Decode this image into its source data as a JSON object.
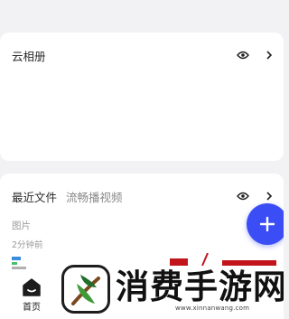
{
  "album_card": {
    "title": "云相册",
    "eye_icon": "eye-icon",
    "chevron_icon": "chevron-right-icon"
  },
  "recent_card": {
    "title": "最近文件",
    "subtitle": "流畅播视频",
    "eye_icon": "eye-icon",
    "chevron_icon": "chevron-right-icon",
    "section_label": "图片",
    "time_label": "2分钟前"
  },
  "fab": {
    "icon": "plus-icon",
    "color": "#3b4ef5"
  },
  "tabbar": {
    "home_label": "首页",
    "home_icon": "home-icon"
  },
  "watermark": {
    "text": "消费手游网",
    "url": "www.xinnanwang.com"
  }
}
